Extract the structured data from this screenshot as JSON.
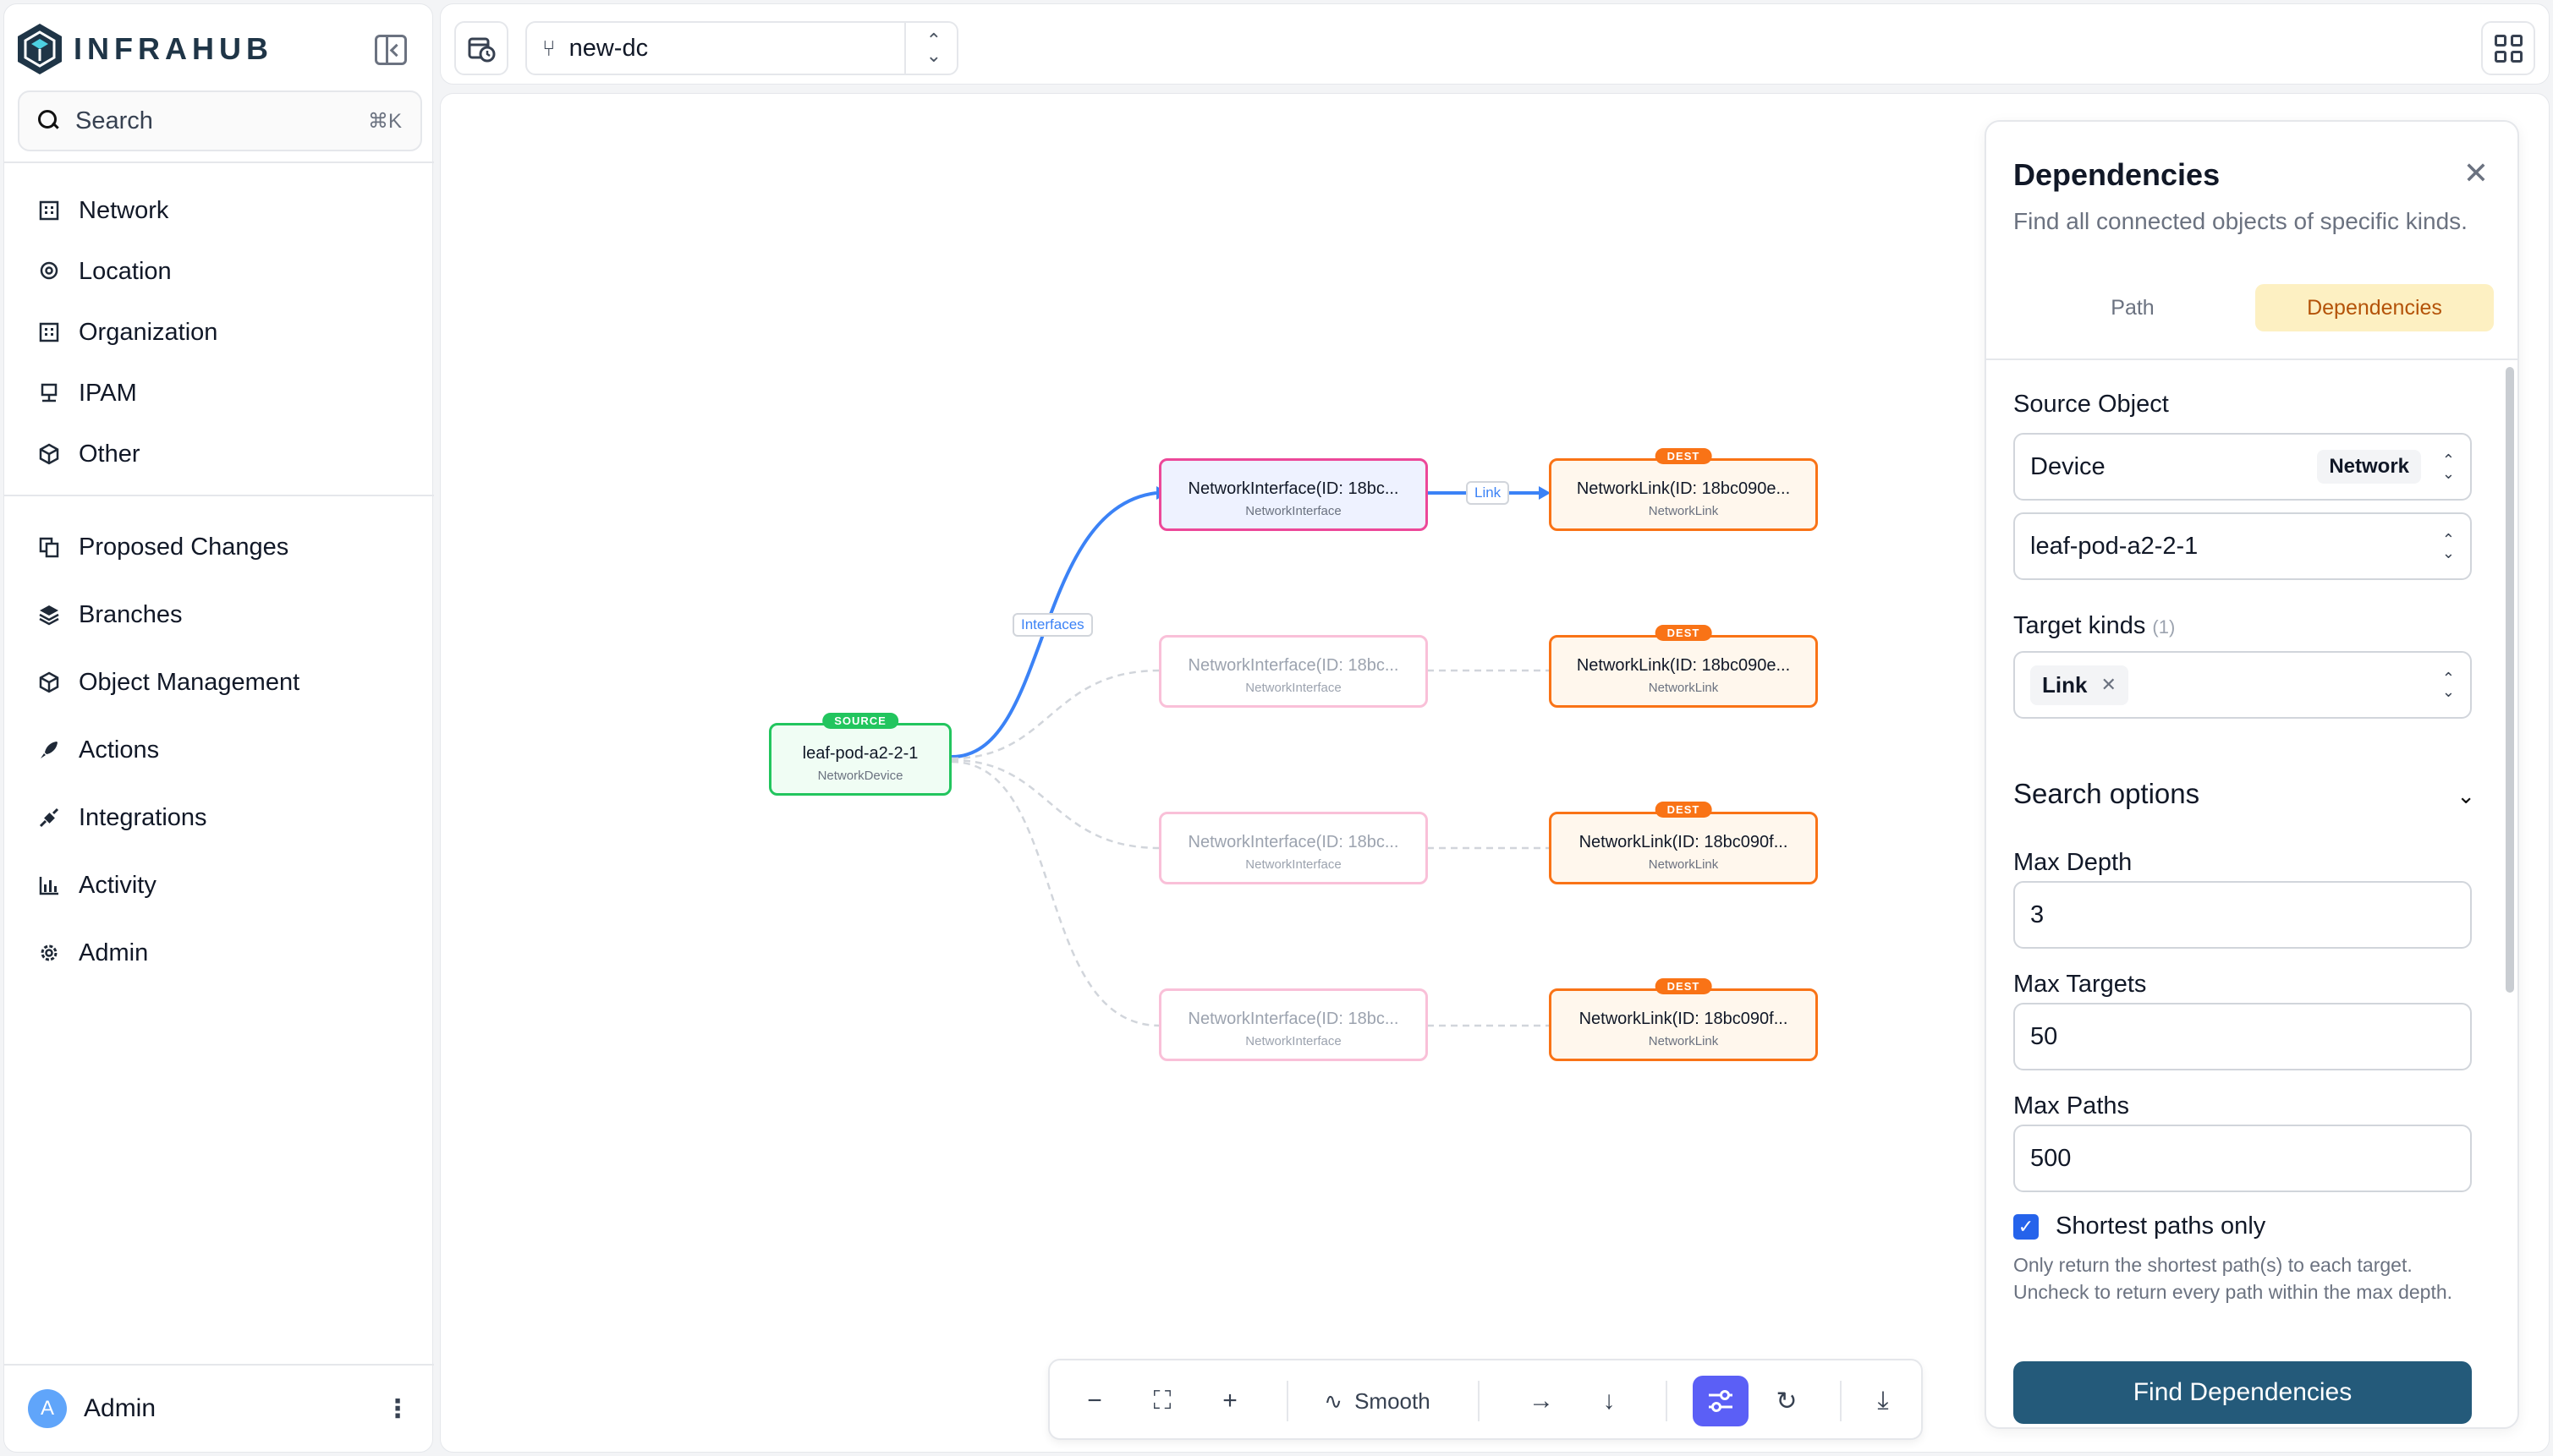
{
  "app": {
    "name": "INFRAHUB",
    "search_label": "Search",
    "search_shortcut": "⌘K"
  },
  "sidebar": {
    "primary": [
      {
        "label": "Network",
        "icon": "building-icon"
      },
      {
        "label": "Location",
        "icon": "map-pin-icon"
      },
      {
        "label": "Organization",
        "icon": "building-icon"
      },
      {
        "label": "IPAM",
        "icon": "network-icon"
      },
      {
        "label": "Other",
        "icon": "cube-icon"
      }
    ],
    "secondary": [
      {
        "label": "Proposed Changes",
        "icon": "git-compare-icon"
      },
      {
        "label": "Branches",
        "icon": "layers-icon"
      },
      {
        "label": "Object Management",
        "icon": "cube-icon"
      },
      {
        "label": "Actions",
        "icon": "rocket-icon"
      },
      {
        "label": "Integrations",
        "icon": "plug-icon"
      },
      {
        "label": "Activity",
        "icon": "bar-chart-icon"
      },
      {
        "label": "Admin",
        "icon": "gear-icon"
      }
    ],
    "user": {
      "initial": "A",
      "name": "Admin"
    }
  },
  "topbar": {
    "branch": "new-dc"
  },
  "graph": {
    "source": {
      "badge": "SOURCE",
      "title": "leaf-pod-a2-2-1",
      "kind": "NetworkDevice"
    },
    "interfaces": [
      {
        "title": "NetworkInterface(ID: 18bc...",
        "kind": "NetworkInterface"
      },
      {
        "title": "NetworkInterface(ID: 18bc...",
        "kind": "NetworkInterface"
      },
      {
        "title": "NetworkInterface(ID: 18bc...",
        "kind": "NetworkInterface"
      },
      {
        "title": "NetworkInterface(ID: 18bc...",
        "kind": "NetworkInterface"
      }
    ],
    "links": [
      {
        "badge": "DEST",
        "title": "NetworkLink(ID: 18bc090e...",
        "kind": "NetworkLink"
      },
      {
        "badge": "DEST",
        "title": "NetworkLink(ID: 18bc090e...",
        "kind": "NetworkLink"
      },
      {
        "badge": "DEST",
        "title": "NetworkLink(ID: 18bc090f...",
        "kind": "NetworkLink"
      },
      {
        "badge": "DEST",
        "title": "NetworkLink(ID: 18bc090f...",
        "kind": "NetworkLink"
      }
    ],
    "edge_labels": {
      "interfaces": "Interfaces",
      "link": "Link"
    }
  },
  "toolbar": {
    "zoom_out": "−",
    "fit": "⛶",
    "zoom_in": "+",
    "smooth_label": "Smooth",
    "arrow_right": "→",
    "arrow_down": "↓",
    "refresh": "↻",
    "download": "⤓"
  },
  "panel": {
    "title": "Dependencies",
    "description": "Find all connected objects of specific kinds.",
    "tabs": [
      "Path",
      "Dependencies"
    ],
    "active_tab": "Dependencies",
    "source_object_label": "Source Object",
    "source_kind": "Device",
    "source_namespace": "Network",
    "source_value": "leaf-pod-a2-2-1",
    "target_kinds_label": "Target kinds",
    "target_kinds_count": "(1)",
    "target_kinds": [
      "Link"
    ],
    "search_options_label": "Search options",
    "max_depth_label": "Max Depth",
    "max_depth": "3",
    "max_targets_label": "Max Targets",
    "max_targets": "50",
    "max_paths_label": "Max Paths",
    "max_paths": "500",
    "shortest_label": "Shortest paths only",
    "shortest_checked": true,
    "shortest_desc": "Only return the shortest path(s) to each target. Uncheck to return every path within the max depth.",
    "find_button": "Find Dependencies"
  },
  "colors": {
    "source_node": "#22c55e",
    "interface_node": "#ec4899",
    "dest_node": "#f97316",
    "active_edge": "#3b82f6",
    "primary_button": "#245a7a",
    "active_tab_bg": "#fdf0c2",
    "active_tool": "#5b5ff6"
  }
}
